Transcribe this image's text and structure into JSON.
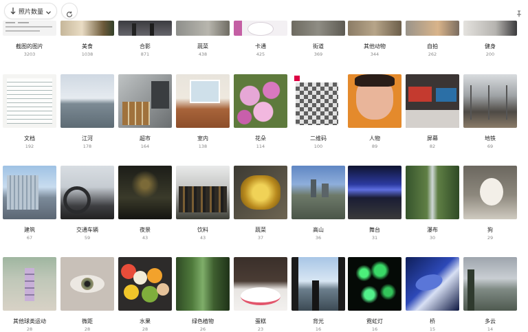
{
  "toolbar": {
    "sort_label": "照片数量",
    "sort_icon": "arrow-down-icon",
    "dropdown_icon": "chevron-down-icon",
    "refresh_icon": "refresh-icon",
    "pin_icon": "pin-icon"
  },
  "categories": [
    {
      "label": "截图的图片",
      "count": "3203"
    },
    {
      "label": "美食",
      "count": "1038"
    },
    {
      "label": "合影",
      "count": "871"
    },
    {
      "label": "蔬菜",
      "count": "438"
    },
    {
      "label": "卡通",
      "count": "425"
    },
    {
      "label": "街道",
      "count": "369"
    },
    {
      "label": "其他动物",
      "count": "344"
    },
    {
      "label": "自拍",
      "count": "262"
    },
    {
      "label": "健身",
      "count": "200"
    },
    {
      "label": "文档",
      "count": "192"
    },
    {
      "label": "江河",
      "count": "178"
    },
    {
      "label": "超市",
      "count": "164"
    },
    {
      "label": "室内",
      "count": "138"
    },
    {
      "label": "花朵",
      "count": "114"
    },
    {
      "label": "二维码",
      "count": "100"
    },
    {
      "label": "人物",
      "count": "89"
    },
    {
      "label": "屏幕",
      "count": "82"
    },
    {
      "label": "地铁",
      "count": "69"
    },
    {
      "label": "建筑",
      "count": "67"
    },
    {
      "label": "交通车辆",
      "count": "59"
    },
    {
      "label": "夜景",
      "count": "43"
    },
    {
      "label": "饮料",
      "count": "43"
    },
    {
      "label": "蔬菜",
      "count": "37"
    },
    {
      "label": "高山",
      "count": "36"
    },
    {
      "label": "舞台",
      "count": "31"
    },
    {
      "label": "瀑布",
      "count": "30"
    },
    {
      "label": "狗",
      "count": "29"
    },
    {
      "label": "其他球类运动",
      "count": "28"
    },
    {
      "label": "微距",
      "count": "28"
    },
    {
      "label": "水果",
      "count": "28"
    },
    {
      "label": "绿色植物",
      "count": "26"
    },
    {
      "label": "蛋糕",
      "count": "23"
    },
    {
      "label": "背光",
      "count": "16"
    },
    {
      "label": "霓虹灯",
      "count": "16"
    },
    {
      "label": "桥",
      "count": "15"
    },
    {
      "label": "多云",
      "count": "14"
    }
  ]
}
